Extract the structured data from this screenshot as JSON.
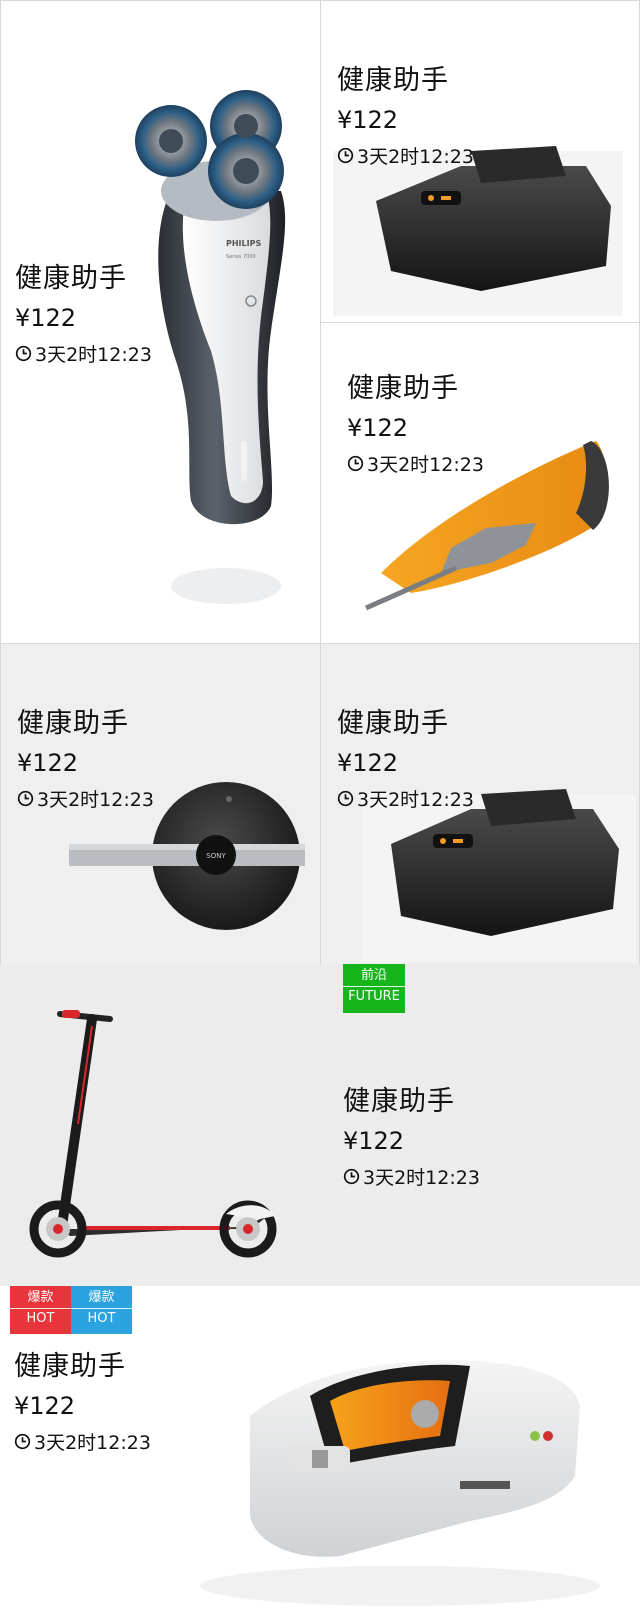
{
  "products": [
    {
      "id": "shaver",
      "title": "健康助手",
      "price": "¥122",
      "countdown": "3天2时12:23"
    },
    {
      "id": "projector-a",
      "title": "健康助手",
      "price": "¥122",
      "countdown": "3天2时12:23"
    },
    {
      "id": "orange-device",
      "title": "健康助手",
      "price": "¥122",
      "countdown": "3天2时12:23"
    },
    {
      "id": "sony-disc",
      "title": "健康助手",
      "price": "¥122",
      "countdown": "3天2时12:23"
    },
    {
      "id": "projector-b",
      "title": "健康助手",
      "price": "¥122",
      "countdown": "3天2时12:23"
    },
    {
      "id": "scooter",
      "title": "健康助手",
      "price": "¥122",
      "countdown": "3天2时12:23"
    },
    {
      "id": "handheld",
      "title": "健康助手",
      "price": "¥122",
      "countdown": "3天2时12:23"
    }
  ],
  "badges": {
    "future": {
      "zh": "前沿",
      "en": "FUTURE",
      "color": "#16b51c"
    },
    "hot_red": {
      "zh": "爆款",
      "en": "HOT",
      "color": "#e8343a"
    },
    "hot_blue": {
      "zh": "爆款",
      "en": "HOT",
      "color": "#2ba3df"
    }
  },
  "icons": {
    "countdown": "clock-icon"
  },
  "colors": {
    "page_bg": "#ffffff",
    "gray_bg": "#efefef",
    "divider": "#d8d8d8",
    "text": "#111111"
  }
}
